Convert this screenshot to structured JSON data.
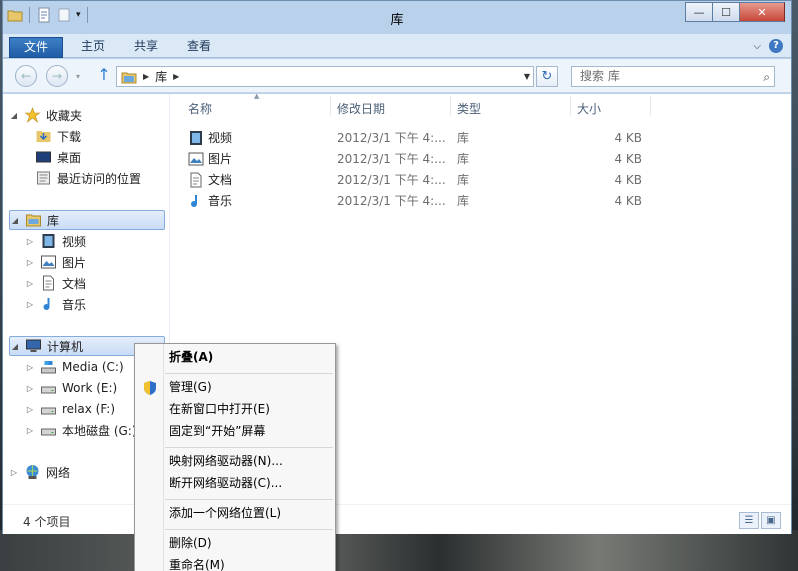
{
  "window": {
    "title": "库",
    "caption": {
      "minimize": "—",
      "maximize": "☐",
      "close": "✕"
    }
  },
  "ribbon": {
    "tabs": [
      "文件",
      "主页",
      "共享",
      "查看"
    ]
  },
  "navigation": {
    "back": "←",
    "forward": "→",
    "up": "↑",
    "address": {
      "segments": [
        "库"
      ]
    },
    "refresh": "↻",
    "search_placeholder": "搜索 库"
  },
  "nav_pane": {
    "favorites": {
      "label": "收藏夹",
      "items": [
        "下载",
        "桌面",
        "最近访问的位置"
      ]
    },
    "libraries": {
      "label": "库",
      "items": [
        "视频",
        "图片",
        "文档",
        "音乐"
      ]
    },
    "computer": {
      "label": "计算机",
      "items": [
        "Media (C:)",
        "Work (E:)",
        "relax (F:)",
        "本地磁盘 (G:)"
      ]
    },
    "network": {
      "label": "网络"
    }
  },
  "file_list": {
    "columns": [
      "名称",
      "修改日期",
      "类型",
      "大小"
    ],
    "rows": [
      {
        "name": "视频",
        "icon": "video-library-icon",
        "date": "2012/3/1 下午 4:...",
        "type": "库",
        "size": "4 KB"
      },
      {
        "name": "图片",
        "icon": "picture-library-icon",
        "date": "2012/3/1 下午 4:...",
        "type": "库",
        "size": "4 KB"
      },
      {
        "name": "文档",
        "icon": "document-library-icon",
        "date": "2012/3/1 下午 4:...",
        "type": "库",
        "size": "4 KB"
      },
      {
        "name": "音乐",
        "icon": "music-library-icon",
        "date": "2012/3/1 下午 4:...",
        "type": "库",
        "size": "4 KB"
      }
    ]
  },
  "status": {
    "count": "4 个项目"
  },
  "context_menu": {
    "items": [
      "折叠(A)",
      "管理(G)",
      "在新窗口中打开(E)",
      "固定到“开始”屏幕",
      "映射网络驱动器(N)...",
      "断开网络驱动器(C)...",
      "添加一个网络位置(L)",
      "删除(D)",
      "重命名(M)"
    ]
  },
  "colors": {
    "accent": "#1f5da6",
    "selection": "#c9dcf5",
    "title_bg": "#b9d1ea"
  }
}
